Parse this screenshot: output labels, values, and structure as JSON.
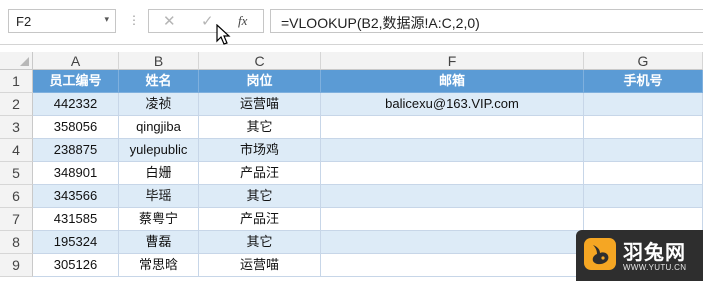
{
  "formula_bar": {
    "name_box": "F2",
    "dropdown_glyph": "▾",
    "separator_glyph": "⋮",
    "cancel_glyph": "✕",
    "enter_glyph": "✓",
    "fx_label": "fx",
    "formula": "=VLOOKUP(B2,数据源!A:C,2,0)"
  },
  "columns": [
    "A",
    "B",
    "C",
    "F",
    "G"
  ],
  "row_numbers": [
    "1",
    "2",
    "3",
    "4",
    "5",
    "6",
    "7",
    "8",
    "9"
  ],
  "header": [
    "员工编号",
    "姓名",
    "岗位",
    "邮箱",
    "手机号"
  ],
  "rows": [
    [
      "442332",
      "凌祯",
      "运营喵",
      "balicexu@163.VIP.com",
      ""
    ],
    [
      "358056",
      "qingjiba",
      "其它",
      "",
      ""
    ],
    [
      "238875",
      "yulepublic",
      "市场鸡",
      "",
      ""
    ],
    [
      "348901",
      "白姗",
      "产品汪",
      "",
      ""
    ],
    [
      "343566",
      "毕瑶",
      "其它",
      "",
      ""
    ],
    [
      "431585",
      "蔡粤宁",
      "产品汪",
      "",
      ""
    ],
    [
      "195324",
      "曹磊",
      "其它",
      "",
      ""
    ],
    [
      "305126",
      "常思晗",
      "运营喵",
      "",
      ""
    ]
  ],
  "colors": {
    "header_fill": "#5b9bd5",
    "band_fill": "#ddebf7",
    "watermark_bg": "#2e2e2e",
    "watermark_accent": "#f5a623"
  },
  "watermark": {
    "brand": "羽兔网",
    "url": "WWW.YUTU.CN",
    "icon": "rabbit-logo-icon"
  }
}
